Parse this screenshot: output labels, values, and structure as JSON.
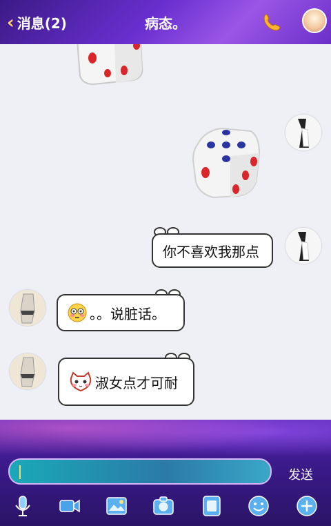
{
  "header": {
    "back_label": "消息(2)",
    "title": "病态。"
  },
  "messages": [
    {
      "side": "left",
      "type": "dice",
      "content": "dice-partial"
    },
    {
      "side": "right",
      "type": "dice",
      "content": "dice-five"
    },
    {
      "side": "right",
      "type": "text",
      "text": "你不喜欢我那点"
    },
    {
      "side": "left",
      "type": "text",
      "emoji": "flushed-emoji",
      "text": "。。说脏话。"
    },
    {
      "side": "left",
      "type": "text",
      "emoji": "cat-emoji",
      "text": "淑女点才可耐"
    }
  ],
  "input": {
    "send_label": "发送"
  },
  "toolbar": {
    "icons": [
      "microphone-icon",
      "video-icon",
      "image-icon",
      "camera-icon",
      "file-icon",
      "emoji-icon",
      "plus-icon"
    ]
  }
}
